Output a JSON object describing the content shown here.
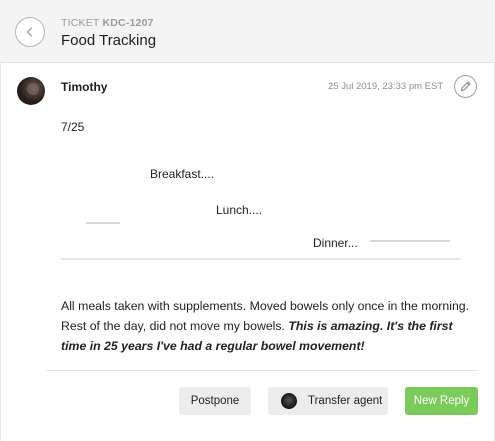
{
  "header": {
    "ticket_label": "TICKET",
    "ticket_id": "KDC-1207",
    "title": "Food Tracking",
    "back_icon": "chevron-left-icon"
  },
  "message": {
    "author": "Timothy",
    "timestamp": "25 Jul 2019, 23:33 pm EST",
    "edit_icon": "pencil-icon",
    "date_line": "7/25",
    "meals": {
      "breakfast": "Breakfast....",
      "lunch": "Lunch....",
      "dinner": "Dinner..."
    },
    "body_plain": "All meals taken with supplements. Moved bowels only once in the morning. Rest of the day, did not move my bowels. ",
    "body_emphasis": "This is amazing.  It's the first time in 25 years I've had a regular bowel movement!"
  },
  "actions": {
    "postpone_label": "Postpone",
    "transfer_label": "Transfer agent",
    "reply_label": "New Reply"
  },
  "colors": {
    "header_bg": "#f4f4f4",
    "reply_button": "#7acb5a",
    "secondary_button": "#ececec"
  }
}
